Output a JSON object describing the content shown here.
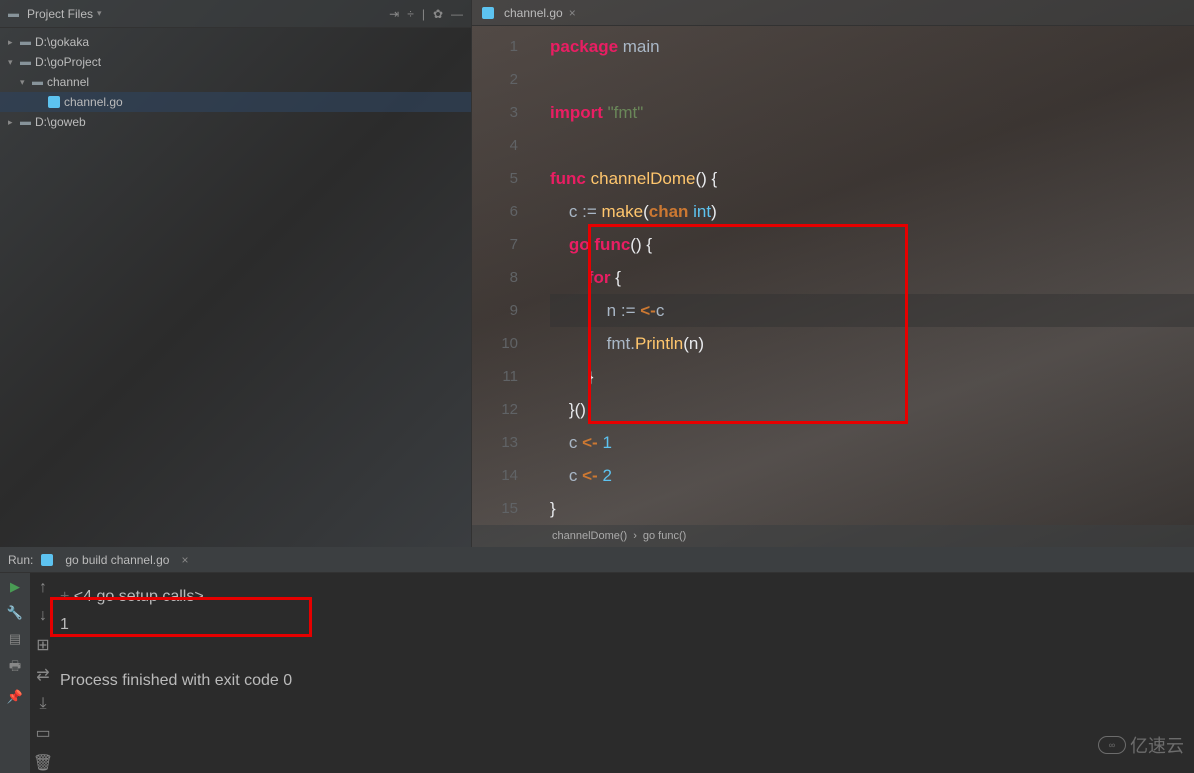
{
  "project": {
    "panel_title": "Project Files",
    "tree": [
      {
        "label": "D:\\gokaka",
        "type": "folder",
        "level": 0,
        "expanded": false
      },
      {
        "label": "D:\\goProject",
        "type": "folder",
        "level": 0,
        "expanded": true
      },
      {
        "label": "channel",
        "type": "folder",
        "level": 1,
        "expanded": true
      },
      {
        "label": "channel.go",
        "type": "gofile",
        "level": 2,
        "selected": true
      },
      {
        "label": "D:\\goweb",
        "type": "folder",
        "level": 0,
        "expanded": false
      }
    ]
  },
  "editor": {
    "tab_name": "channel.go",
    "breadcrumb": {
      "fn": "channelDome()",
      "sub": "go func()"
    },
    "current_line": 9,
    "lines": [
      {
        "n": 1,
        "tokens": [
          {
            "t": "package ",
            "c": "kw2"
          },
          {
            "t": "main",
            "c": "id"
          }
        ]
      },
      {
        "n": 2,
        "tokens": []
      },
      {
        "n": 3,
        "tokens": [
          {
            "t": "import ",
            "c": "kw2"
          },
          {
            "t": "\"fmt\"",
            "c": "str"
          }
        ]
      },
      {
        "n": 4,
        "tokens": []
      },
      {
        "n": 5,
        "tokens": [
          {
            "t": "func ",
            "c": "kw2"
          },
          {
            "t": "channelDome",
            "c": "fn"
          },
          {
            "t": "() {",
            "c": "brace"
          }
        ]
      },
      {
        "n": 6,
        "tokens": [
          {
            "t": "    c ",
            "c": "id"
          },
          {
            "t": ":= ",
            "c": "op"
          },
          {
            "t": "make",
            "c": "fn"
          },
          {
            "t": "(",
            "c": "brace"
          },
          {
            "t": "chan ",
            "c": "kw"
          },
          {
            "t": "int",
            "c": "typ"
          },
          {
            "t": ")",
            "c": "brace"
          }
        ]
      },
      {
        "n": 7,
        "tokens": [
          {
            "t": "    ",
            "c": "id"
          },
          {
            "t": "go func",
            "c": "kw2"
          },
          {
            "t": "() {",
            "c": "brace"
          }
        ]
      },
      {
        "n": 8,
        "tokens": [
          {
            "t": "        ",
            "c": "id"
          },
          {
            "t": "for ",
            "c": "kw2"
          },
          {
            "t": "{",
            "c": "brace"
          }
        ]
      },
      {
        "n": 9,
        "tokens": [
          {
            "t": "            n ",
            "c": "id"
          },
          {
            "t": ":= ",
            "c": "op"
          },
          {
            "t": "<-",
            "c": "kw"
          },
          {
            "t": "c",
            "c": "id"
          }
        ]
      },
      {
        "n": 10,
        "tokens": [
          {
            "t": "            fmt.",
            "c": "id"
          },
          {
            "t": "Println",
            "c": "fn"
          },
          {
            "t": "(n)",
            "c": "brace"
          }
        ]
      },
      {
        "n": 11,
        "tokens": [
          {
            "t": "        }",
            "c": "brace"
          }
        ]
      },
      {
        "n": 12,
        "tokens": [
          {
            "t": "    }()",
            "c": "brace"
          }
        ]
      },
      {
        "n": 13,
        "tokens": [
          {
            "t": "    c ",
            "c": "id"
          },
          {
            "t": "<- ",
            "c": "kw"
          },
          {
            "t": "1",
            "c": "typ"
          }
        ]
      },
      {
        "n": 14,
        "tokens": [
          {
            "t": "    c ",
            "c": "id"
          },
          {
            "t": "<- ",
            "c": "kw"
          },
          {
            "t": "2",
            "c": "typ"
          }
        ]
      },
      {
        "n": 15,
        "tokens": [
          {
            "t": "}",
            "c": "brace"
          }
        ]
      }
    ]
  },
  "run": {
    "label": "Run:",
    "config_name": "go build channel.go",
    "output": {
      "setup": "<4 go setup calls>",
      "line1": "1",
      "finished": "Process finished with exit code 0"
    }
  },
  "watermark": "亿速云"
}
